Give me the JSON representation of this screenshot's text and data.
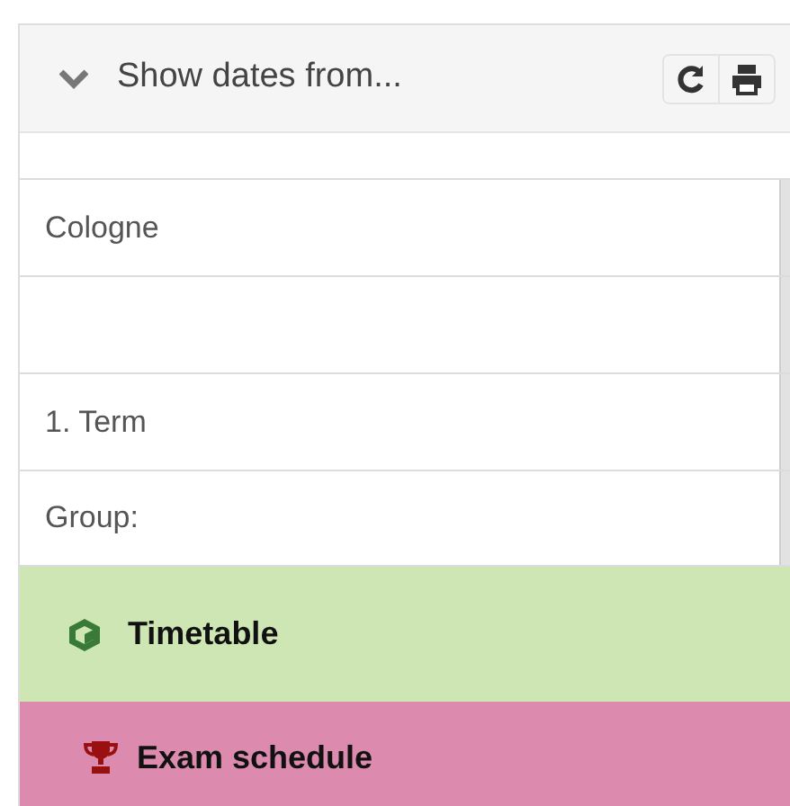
{
  "panel": {
    "title": "Show dates from...",
    "expanded": true
  },
  "filters": [
    {
      "kind": "select",
      "value": "Cologne"
    },
    {
      "kind": "select"
    },
    {
      "kind": "select",
      "value": "1. Term"
    },
    {
      "kind": "select",
      "value": "Group:"
    }
  ],
  "links": [
    {
      "label": "Timetable",
      "kind": "timetable",
      "color": "#cde6b3"
    },
    {
      "label": "Exam schedule",
      "kind": "exam",
      "color": "#dc8aad"
    }
  ]
}
